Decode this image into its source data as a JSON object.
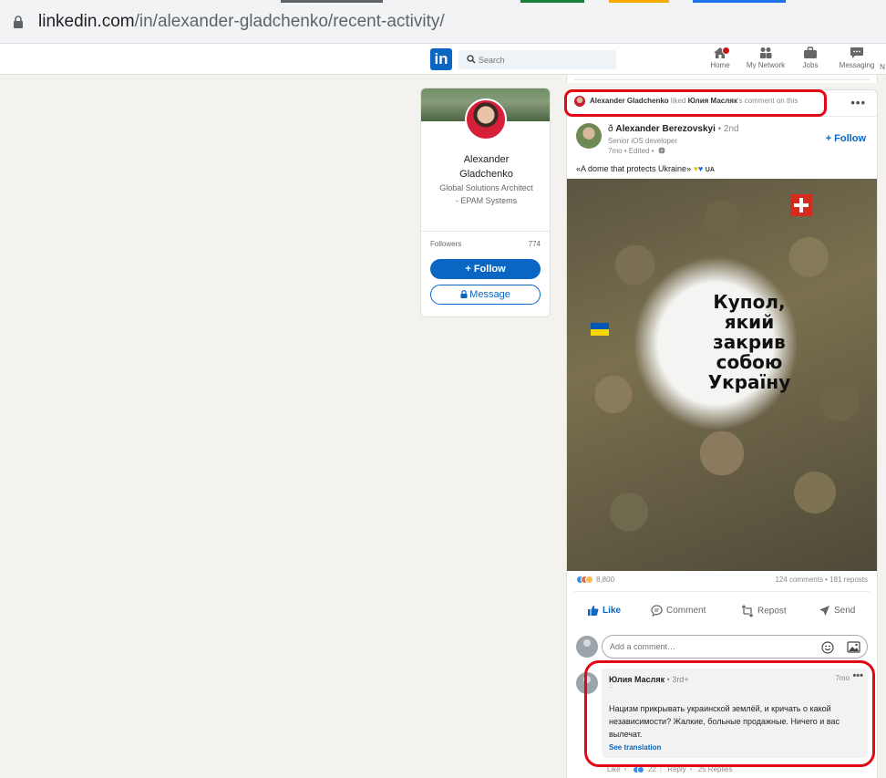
{
  "browser": {
    "url_host": "linkedin.com",
    "url_path": "/in/alexander-gladchenko/recent-activity/"
  },
  "nav": {
    "logo": "in",
    "search_placeholder": "Search",
    "items": [
      {
        "label": "Home"
      },
      {
        "label": "My Network"
      },
      {
        "label": "Jobs"
      },
      {
        "label": "Messaging"
      },
      {
        "label": "N"
      }
    ]
  },
  "profile": {
    "name_line1": "Alexander",
    "name_line2": "Gladchenko",
    "title": "Global Solutions Architect - EPAM Systems",
    "followers_label": "Followers",
    "followers_count": "774",
    "follow_label": "+ Follow",
    "message_label": "Message"
  },
  "post": {
    "activity_actor": "Alexander Gladchenko",
    "activity_verb": " liked ",
    "activity_target": "Юлия Масляк",
    "activity_suffix": "'s comment on this",
    "author_prefix": "ð ",
    "author_name": "Alexander Berezovskyi",
    "author_degree": " • 2nd",
    "author_headline": "Senior iOS developer",
    "author_time": "7mo • Edited •",
    "follow_label": "+ Follow",
    "text": "«A dome that protects Ukraine»",
    "text_tag": "UA",
    "image_caption": "Купол, який закрив собою Україну",
    "reactions_count": "8,800",
    "comments_reposts": "124 comments • 181 reposts",
    "actions": {
      "like": "Like",
      "comment": "Comment",
      "repost": "Repost",
      "send": "Send"
    },
    "comment_placeholder": "Add a comment…"
  },
  "comment": {
    "author": "Юлия Масляк",
    "degree": " • 3rd+",
    "sub": "--",
    "time": "7mo",
    "text": "Нацизм прикрывать украинской землёй, и кричать о какой независимости? Жалкие, больные продажные. Ничего и вас вылечат.",
    "see_translation": "See translation",
    "like": "Like",
    "reaction_count": "22",
    "reply": "Reply",
    "replies": "25 Replies"
  },
  "colors": {
    "linkedin_blue": "#0a66c2",
    "annotation_red": "#e30613",
    "page_bg": "#f3f2ef"
  }
}
